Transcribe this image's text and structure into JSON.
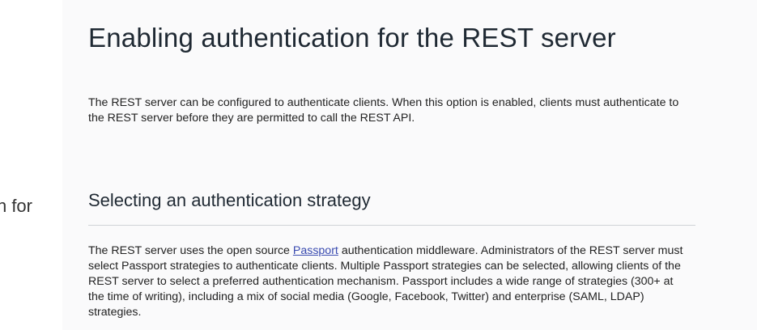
{
  "sidebar": {
    "fragment_text": "n for"
  },
  "main": {
    "title": "Enabling authentication for the REST server",
    "intro": "The REST server can be configured to authenticate clients. When this option is enabled, clients must authenticate to the REST server before they are permitted to call the REST API.",
    "section": {
      "title": "Selecting an authentication strategy",
      "body_before_link": "The REST server uses the open source ",
      "link_text": "Passport",
      "body_after_link": " authentication middleware. Administrators of the REST server must select Passport strategies to authenticate clients. Multiple Passport strategies can be selected, allowing clients of the REST server to select a preferred authentication mechanism. Passport includes a wide range of strategies (300+ at the time of writing), including a mix of social media (Google, Facebook, Twitter) and enterprise (SAML, LDAP) strategies."
    }
  },
  "colors": {
    "content_background": "#fafafb",
    "link": "#3a4bb0",
    "divider": "#cfd3d7"
  }
}
